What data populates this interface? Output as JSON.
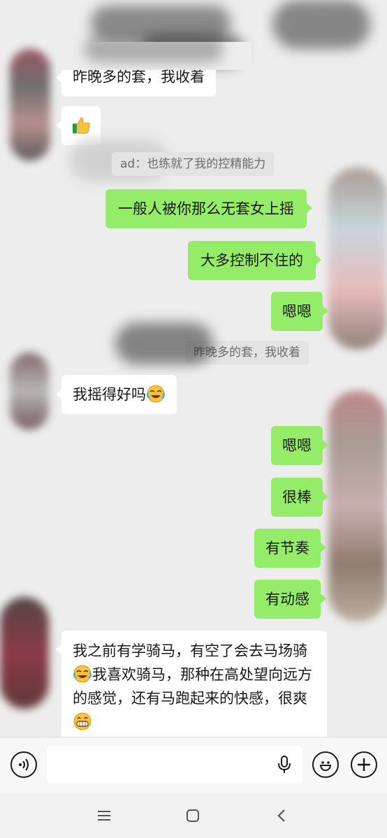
{
  "messages": {
    "partial_top": "昨晚多的套，我收着",
    "quote1": "ad：也练就了我的控精能力",
    "out1": "一般人被你那么无套女上摇",
    "out2": "大多控制不住的",
    "out3": "嗯嗯",
    "quote2": "昨晚多的套，我收着",
    "in1": "我摇得好吗",
    "out4": "嗯嗯",
    "out5": "很棒",
    "out6": "有节奏",
    "out7": "有动感",
    "in2_part1": "我之前有学骑马，有空了会去马场骑",
    "in2_part2": "我喜欢骑马，那种在高处望向远方的感觉，还有马跑起来的快感，很爽"
  },
  "icons": {
    "thumbs_up": "thumbs-up-emoji",
    "laugh_cry": "laughing-crying-emoji",
    "grin": "grinning-emoji",
    "voice": "voice-input-icon",
    "mic": "microphone-icon",
    "sticker": "emoji-smile-icon",
    "plus": "plus-icon",
    "menu": "menu-icon",
    "home": "home-icon",
    "back": "back-icon"
  },
  "colors": {
    "background": "#ededed",
    "incoming_bubble": "#ffffff",
    "outgoing_bubble": "#95ec69",
    "quote_bg": "#e3e3e3"
  }
}
